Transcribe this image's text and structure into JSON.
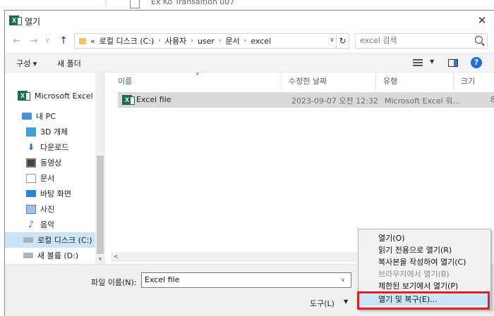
{
  "background_window": {
    "title": "Ex Ko Transaltion 007"
  },
  "dialog": {
    "title": "열기",
    "close_glyph": "✕"
  },
  "nav": {
    "back": "←",
    "forward": "→",
    "recent": "∨",
    "up": "↑"
  },
  "address": {
    "overflow": "«",
    "crumbs": [
      "로컬 디스크 (C:)",
      "사용자",
      "user",
      "문서",
      "excel"
    ],
    "separator": "›",
    "dropdown": "∨",
    "refresh": "↻"
  },
  "search": {
    "placeholder": "excel 검색"
  },
  "toolbar": {
    "organize": "구성 ▾",
    "new_folder": "새 폴더",
    "view_drop": "▼",
    "help": "?"
  },
  "sidebar": {
    "app_entry": "Microsoft Excel",
    "items": [
      "내 PC",
      "3D 개체",
      "다운로드",
      "동영상",
      "문서",
      "바탕 화면",
      "사진",
      "음악",
      "로컬 디스크 (C:)",
      "새 볼륨 (D:)"
    ],
    "selected_index": 8,
    "scroll_down": "∨"
  },
  "columns": {
    "name": "이름",
    "modified": "수정한 날짜",
    "type": "유형",
    "size": "크기",
    "sort_caret": "∨"
  },
  "files": [
    {
      "name": "Excel file",
      "modified": "2023-09-07 오전 12:32",
      "type": "Microsoft Excel 워...",
      "size": "8"
    }
  ],
  "hscroll": {
    "left_arrow": "<"
  },
  "bottom": {
    "filename_label": "파일 이름(N):",
    "filename_value": "Excel file",
    "filename_drop": "∨",
    "tools_label": "도구(L)",
    "tools_drop": "▼"
  },
  "open_menu": {
    "items": [
      {
        "label": "열기(O)",
        "disabled": false
      },
      {
        "label": "읽기 전용으로 열기(R)",
        "disabled": false
      },
      {
        "label": "복사본을 작성하여 열기(C)",
        "disabled": false
      },
      {
        "label": "브라우저에서 열기(B)",
        "disabled": true
      },
      {
        "label": "제한된 보기에서 열기(P)",
        "disabled": false
      },
      {
        "label": "열기 및 복구(E)...",
        "disabled": false
      }
    ],
    "highlighted_index": 5,
    "highlight_color": "#e02020"
  },
  "colors": {
    "accent": "#1f6fd1",
    "excel_green": "#1d6f42",
    "selection": "#cce4f7"
  }
}
